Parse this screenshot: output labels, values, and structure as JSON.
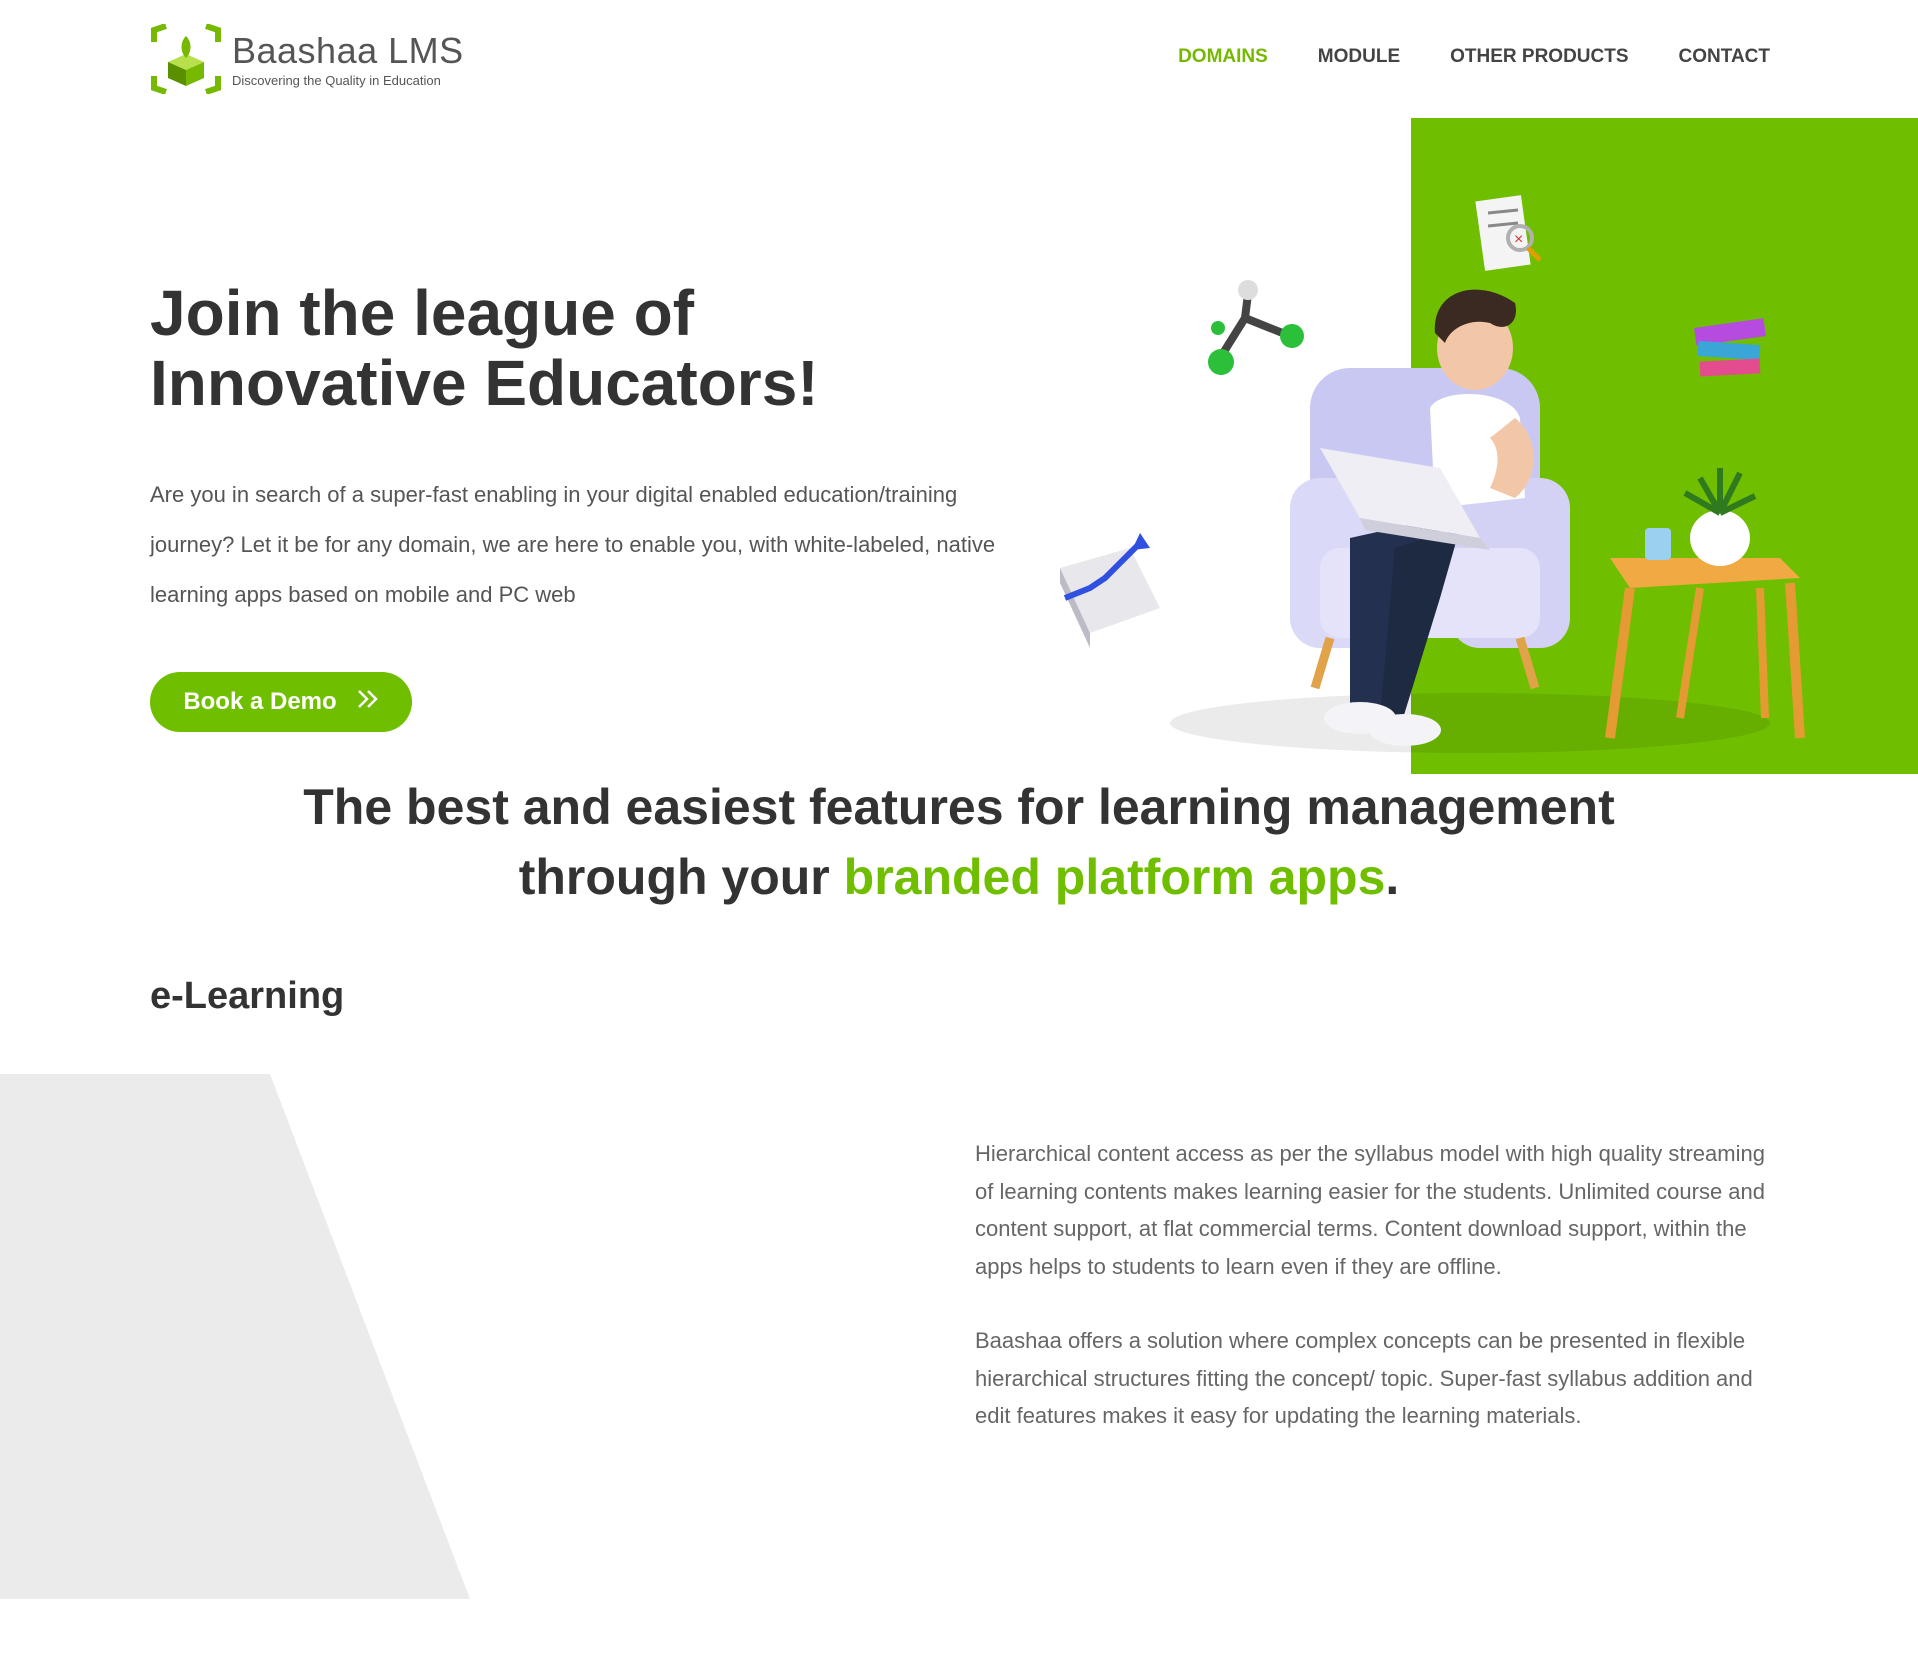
{
  "brand": {
    "name": "Baashaa LMS",
    "tagline": "Discovering the Quality in Education",
    "accent_color": "#6fbe00"
  },
  "nav": {
    "items": [
      {
        "label": "DOMAINS",
        "active": true
      },
      {
        "label": "MODULE",
        "active": false
      },
      {
        "label": "OTHER PRODUCTS",
        "active": false
      },
      {
        "label": "CONTACT",
        "active": false
      }
    ]
  },
  "hero": {
    "title_line1": "Join the league of",
    "title_line2": "Innovative Educators!",
    "description": "Are you in search of a super-fast enabling in your digital enabled education/training journey? Let it be for any domain, we are here to enable you, with white-labeled, native learning apps based on mobile and PC web",
    "cta_label": "Book a Demo",
    "cta_icon": "double-chevron-right-icon"
  },
  "features": {
    "title_part1": "The best and easiest features for learning management",
    "title_part2": "through your ",
    "title_accent": "branded platform apps",
    "title_end": "."
  },
  "elearning": {
    "heading": "e-Learning",
    "paragraph1": "Hierarchical content access as per the syllabus model with high quality streaming of learning contents makes learning easier for the students. Unlimited course and content support, at flat commercial terms. Content download support, within the apps helps to students to learn even if they are offline.",
    "paragraph2": "Baashaa offers a solution where complex concepts can be presented in flexible hierarchical structures fitting the concept/ topic. Super-fast syllabus addition and edit features makes it easy for updating the learning materials."
  }
}
